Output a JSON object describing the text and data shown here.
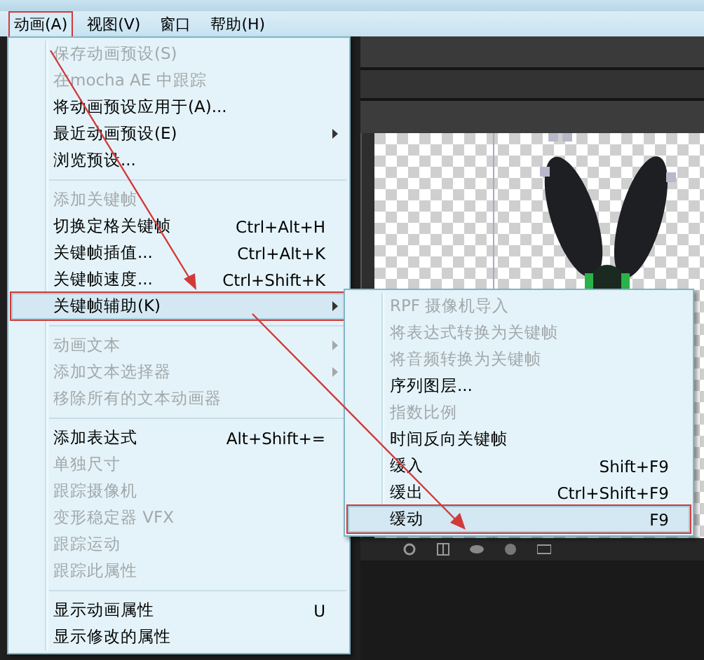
{
  "menubar": [
    {
      "label": "动画(A)",
      "selected": true,
      "annotated": true
    },
    {
      "label": "视图(V)",
      "selected": false,
      "annotated": false
    },
    {
      "label": "窗口",
      "selected": false,
      "annotated": false
    },
    {
      "label": "帮助(H)",
      "selected": false,
      "annotated": false
    }
  ],
  "menu": {
    "items": [
      {
        "kind": "item",
        "label": "保存动画预设(S)",
        "disabled": true,
        "selected": false,
        "annotated": false
      },
      {
        "kind": "item",
        "label": "在mocha AE 中跟踪",
        "disabled": true,
        "selected": false,
        "annotated": false
      },
      {
        "kind": "item",
        "label": "将动画预设应用于(A)...",
        "disabled": false,
        "selected": false,
        "annotated": false
      },
      {
        "kind": "item",
        "label": "最近动画预设(E)",
        "disabled": false,
        "submenu": true,
        "selected": false,
        "annotated": false
      },
      {
        "kind": "item",
        "label": "浏览预设...",
        "disabled": false,
        "selected": false,
        "annotated": false
      },
      {
        "kind": "separator"
      },
      {
        "kind": "item",
        "label": "添加关键帧",
        "disabled": true,
        "selected": false,
        "annotated": false
      },
      {
        "kind": "item",
        "label": "切换定格关键帧",
        "shortcut": "Ctrl+Alt+H",
        "disabled": false,
        "selected": false,
        "annotated": false
      },
      {
        "kind": "item",
        "label": "关键帧插值...",
        "shortcut": "Ctrl+Alt+K",
        "disabled": false,
        "selected": false,
        "annotated": false
      },
      {
        "kind": "item",
        "label": "关键帧速度...",
        "shortcut": "Ctrl+Shift+K",
        "disabled": false,
        "selected": false,
        "annotated": false
      },
      {
        "kind": "item",
        "label": "关键帧辅助(K)",
        "disabled": false,
        "submenu": true,
        "selected": true,
        "annotated": true
      },
      {
        "kind": "separator"
      },
      {
        "kind": "item",
        "label": "动画文本",
        "disabled": true,
        "submenu": true,
        "selected": false,
        "annotated": false
      },
      {
        "kind": "item",
        "label": "添加文本选择器",
        "disabled": true,
        "submenu": true,
        "selected": false,
        "annotated": false
      },
      {
        "kind": "item",
        "label": "移除所有的文本动画器",
        "disabled": true,
        "selected": false,
        "annotated": false
      },
      {
        "kind": "separator"
      },
      {
        "kind": "item",
        "label": "添加表达式",
        "shortcut": "Alt+Shift+=",
        "disabled": false,
        "selected": false,
        "annotated": false
      },
      {
        "kind": "item",
        "label": "单独尺寸",
        "disabled": true,
        "selected": false,
        "annotated": false
      },
      {
        "kind": "item",
        "label": "跟踪摄像机",
        "disabled": true,
        "selected": false,
        "annotated": false
      },
      {
        "kind": "item",
        "label": "变形稳定器 VFX",
        "disabled": true,
        "selected": false,
        "annotated": false
      },
      {
        "kind": "item",
        "label": "跟踪运动",
        "disabled": true,
        "selected": false,
        "annotated": false
      },
      {
        "kind": "item",
        "label": "跟踪此属性",
        "disabled": true,
        "selected": false,
        "annotated": false
      },
      {
        "kind": "separator"
      },
      {
        "kind": "item",
        "label": "显示动画属性",
        "shortcut": "U",
        "disabled": false,
        "selected": false,
        "annotated": false
      },
      {
        "kind": "item",
        "label": "显示修改的属性",
        "disabled": false,
        "selected": false,
        "annotated": false
      }
    ]
  },
  "submenu": {
    "items": [
      {
        "kind": "item",
        "label": "RPF 摄像机导入",
        "disabled": true,
        "selected": false,
        "annotated": false
      },
      {
        "kind": "item",
        "label": "将表达式转换为关键帧",
        "disabled": true,
        "selected": false,
        "annotated": false
      },
      {
        "kind": "item",
        "label": "将音频转换为关键帧",
        "disabled": true,
        "selected": false,
        "annotated": false
      },
      {
        "kind": "item",
        "label": "序列图层...",
        "disabled": false,
        "selected": false,
        "annotated": false
      },
      {
        "kind": "item",
        "label": "指数比例",
        "disabled": true,
        "selected": false,
        "annotated": false
      },
      {
        "kind": "item",
        "label": "时间反向关键帧",
        "disabled": false,
        "selected": false,
        "annotated": false
      },
      {
        "kind": "item",
        "label": "缓入",
        "shortcut": "Shift+F9",
        "disabled": false,
        "selected": false,
        "annotated": false
      },
      {
        "kind": "item",
        "label": "缓出",
        "shortcut": "Ctrl+Shift+F9",
        "disabled": false,
        "selected": false,
        "annotated": false
      },
      {
        "kind": "item",
        "label": "缓动",
        "shortcut": "F9",
        "disabled": false,
        "selected": true,
        "annotated": true
      }
    ]
  }
}
